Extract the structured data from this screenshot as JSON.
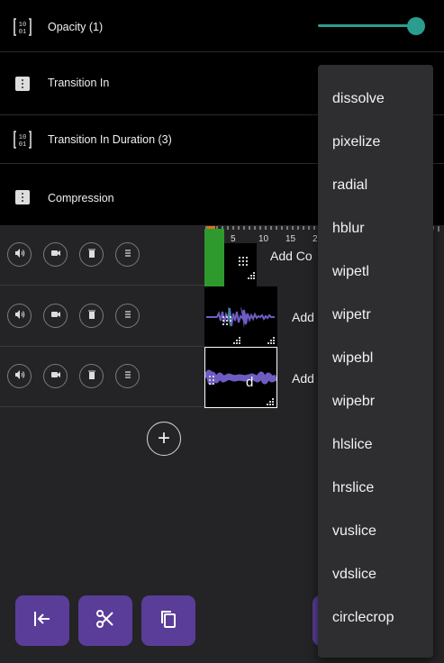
{
  "properties": [
    {
      "label": "Opacity (1)",
      "icon": "binary-icon",
      "slider_value": 1
    },
    {
      "label": "Transition In",
      "icon": "select-icon"
    },
    {
      "label": "Transition In Duration (3)",
      "icon": "binary-icon"
    },
    {
      "label": "Compression",
      "icon": "select-icon"
    }
  ],
  "ruler": {
    "ticks": [
      "5",
      "10",
      "15",
      "2"
    ]
  },
  "tracks": [
    {
      "add_label": "Add Co"
    },
    {
      "add_label": "Add"
    },
    {
      "add_label": "Add"
    }
  ],
  "clip_text": "d",
  "add_track_label": "+",
  "transition_options": [
    "dissolve",
    "pixelize",
    "radial",
    "hblur",
    "wipetl",
    "wipetr",
    "wipebl",
    "wipebr",
    "hlslice",
    "hrslice",
    "vuslice",
    "vdslice",
    "circlecrop"
  ],
  "colors": {
    "accent": "#2a9d8f",
    "button": "#5a3d99",
    "waveform": "#6f5cc3",
    "clip_green": "#2e9a2e"
  }
}
